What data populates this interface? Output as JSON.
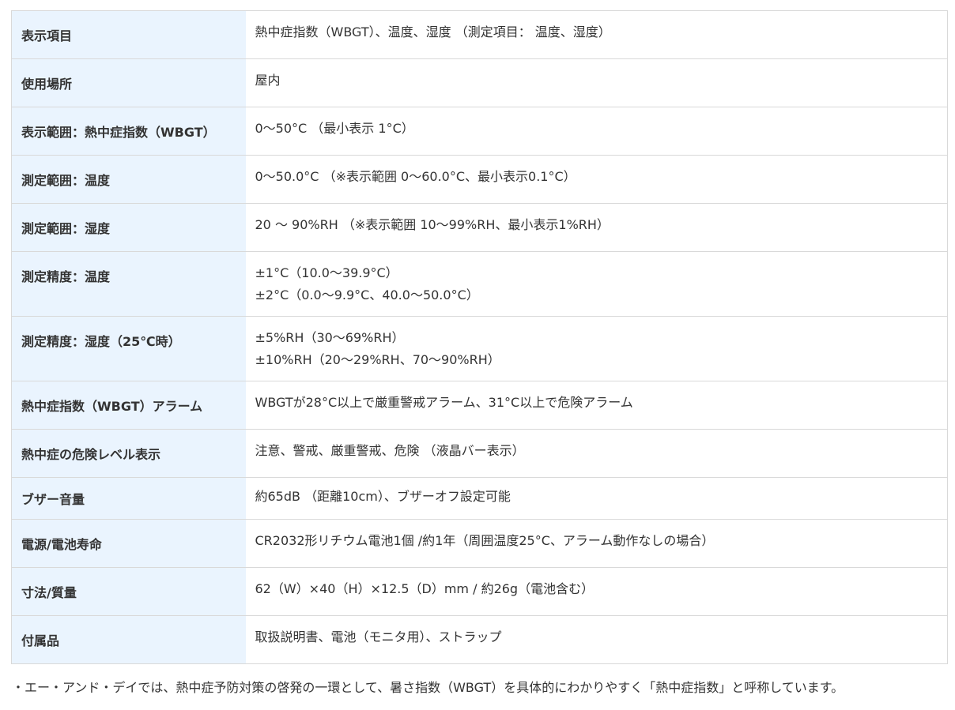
{
  "specs": [
    {
      "label": "表示項目",
      "lines": [
        "熱中症指数（WBGT）、温度、湿度 （測定項目： 温度、湿度）"
      ]
    },
    {
      "label": "使用場所",
      "lines": [
        "屋内"
      ]
    },
    {
      "label": "表示範囲：熱中症指数（WBGT）",
      "lines": [
        "0〜50°C （最小表示 1°C）"
      ]
    },
    {
      "label": "測定範囲：温度",
      "lines": [
        "0〜50.0°C （※表示範囲 0〜60.0°C、最小表示0.1°C）"
      ]
    },
    {
      "label": "測定範囲：湿度",
      "lines": [
        "20 〜 90%RH （※表示範囲 10〜99%RH、最小表示1%RH）"
      ]
    },
    {
      "label": "測定精度：温度",
      "lines": [
        "±1°C（10.0〜39.9°C）",
        "±2°C（0.0〜9.9°C、40.0〜50.0°C）"
      ]
    },
    {
      "label": "測定精度：湿度（25℃時）",
      "lines": [
        "±5%RH（30〜69%RH）",
        "±10%RH（20〜29%RH、70〜90%RH）"
      ]
    },
    {
      "label": "熱中症指数（WBGT）アラーム",
      "lines": [
        "WBGTが28°C以上で厳重警戒アラーム、31°C以上で危険アラーム"
      ]
    },
    {
      "label": "熱中症の危険レベル表示",
      "lines": [
        "注意、警戒、厳重警戒、危険 （液晶バー表示）"
      ]
    },
    {
      "label": "ブザー音量",
      "lines": [
        "約65dB （距離10cm）、ブザーオフ設定可能"
      ]
    },
    {
      "label": "電源/電池寿命",
      "lines": [
        "CR2032形リチウム電池1個 /約1年（周囲温度25°C、アラーム動作なしの場合）"
      ]
    },
    {
      "label": "寸法/質量",
      "lines": [
        "62（W）×40（H）×12.5（D）mm / 約26g（電池含む）"
      ]
    },
    {
      "label": "付属品",
      "lines": [
        "取扱説明書、電池（モニタ用）、ストラップ"
      ]
    }
  ],
  "footnote": "・エー・アンド・デイでは、熱中症予防対策の啓発の一環として、暑さ指数（WBGT）を具体的にわかりやすく「熱中症指数」と呼称しています。"
}
